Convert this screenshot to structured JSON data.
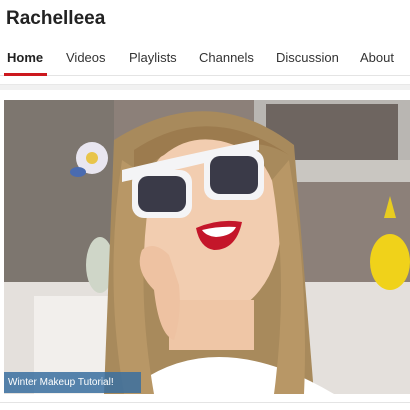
{
  "channel": {
    "name": "Rachelleea"
  },
  "tabs": [
    {
      "label": "Home",
      "active": true
    },
    {
      "label": "Videos",
      "active": false
    },
    {
      "label": "Playlists",
      "active": false
    },
    {
      "label": "Channels",
      "active": false
    },
    {
      "label": "Discussion",
      "active": false
    },
    {
      "label": "About",
      "active": false
    }
  ],
  "featured_video": {
    "caption": "Winter Makeup Tutorial!"
  },
  "colors": {
    "accent": "#cc181e",
    "caption_bg": "#3a6ea0"
  }
}
